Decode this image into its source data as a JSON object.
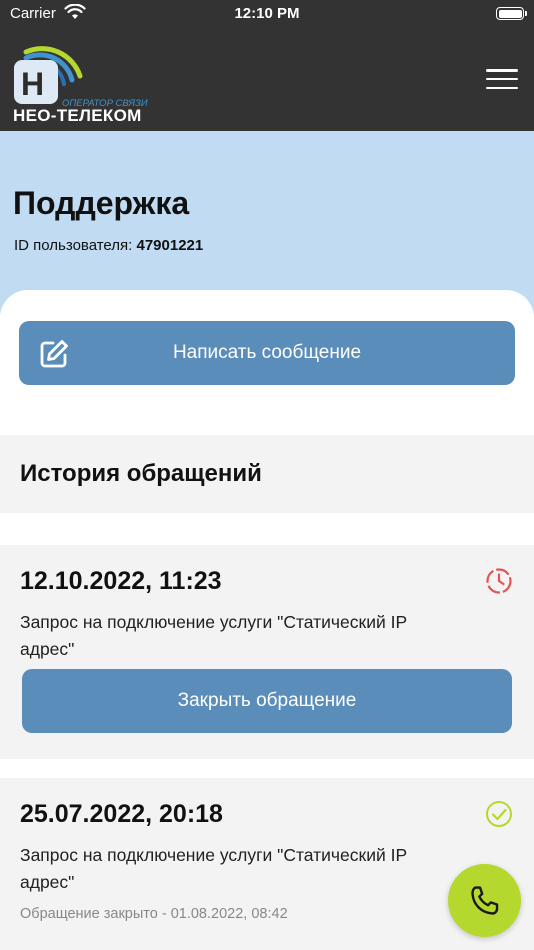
{
  "status_bar": {
    "carrier": "Carrier",
    "time": "12:10 PM"
  },
  "header": {
    "logo_letter": "Н",
    "logo_subtitle": "ОПЕРАТОР СВЯЗИ",
    "logo_name": "НЕО-ТЕЛЕКОМ",
    "menu_icon": "hamburger-icon"
  },
  "page": {
    "title": "Поддержка",
    "user_id_label": "ID пользователя:",
    "user_id_value": "47901221"
  },
  "write_message": {
    "label": "Написать сообщение",
    "icon": "edit-icon"
  },
  "history": {
    "title": "История обращений",
    "tickets": [
      {
        "date": "12.10.2022, 11:23",
        "description": "Запрос на подключение услуги \"Статический IP адрес\"",
        "status_icon": "clock-pending-icon",
        "close_label": "Закрыть обращение"
      },
      {
        "date": "25.07.2022, 20:18",
        "description": "Запрос на подключение услуги \"Статический IP адрес\"",
        "status_icon": "check-circle-icon",
        "closed_note": "Обращение закрыто - 01.08.2022, 08:42"
      }
    ]
  },
  "colors": {
    "header_bg": "#333333",
    "hero_bg": "#c1dcf2",
    "button_bg": "#5a8db9",
    "accent_green": "#b4d82e",
    "pending_red": "#e05656",
    "logo_blue": "#3f93cf"
  },
  "call_button": {
    "icon": "phone-icon"
  }
}
